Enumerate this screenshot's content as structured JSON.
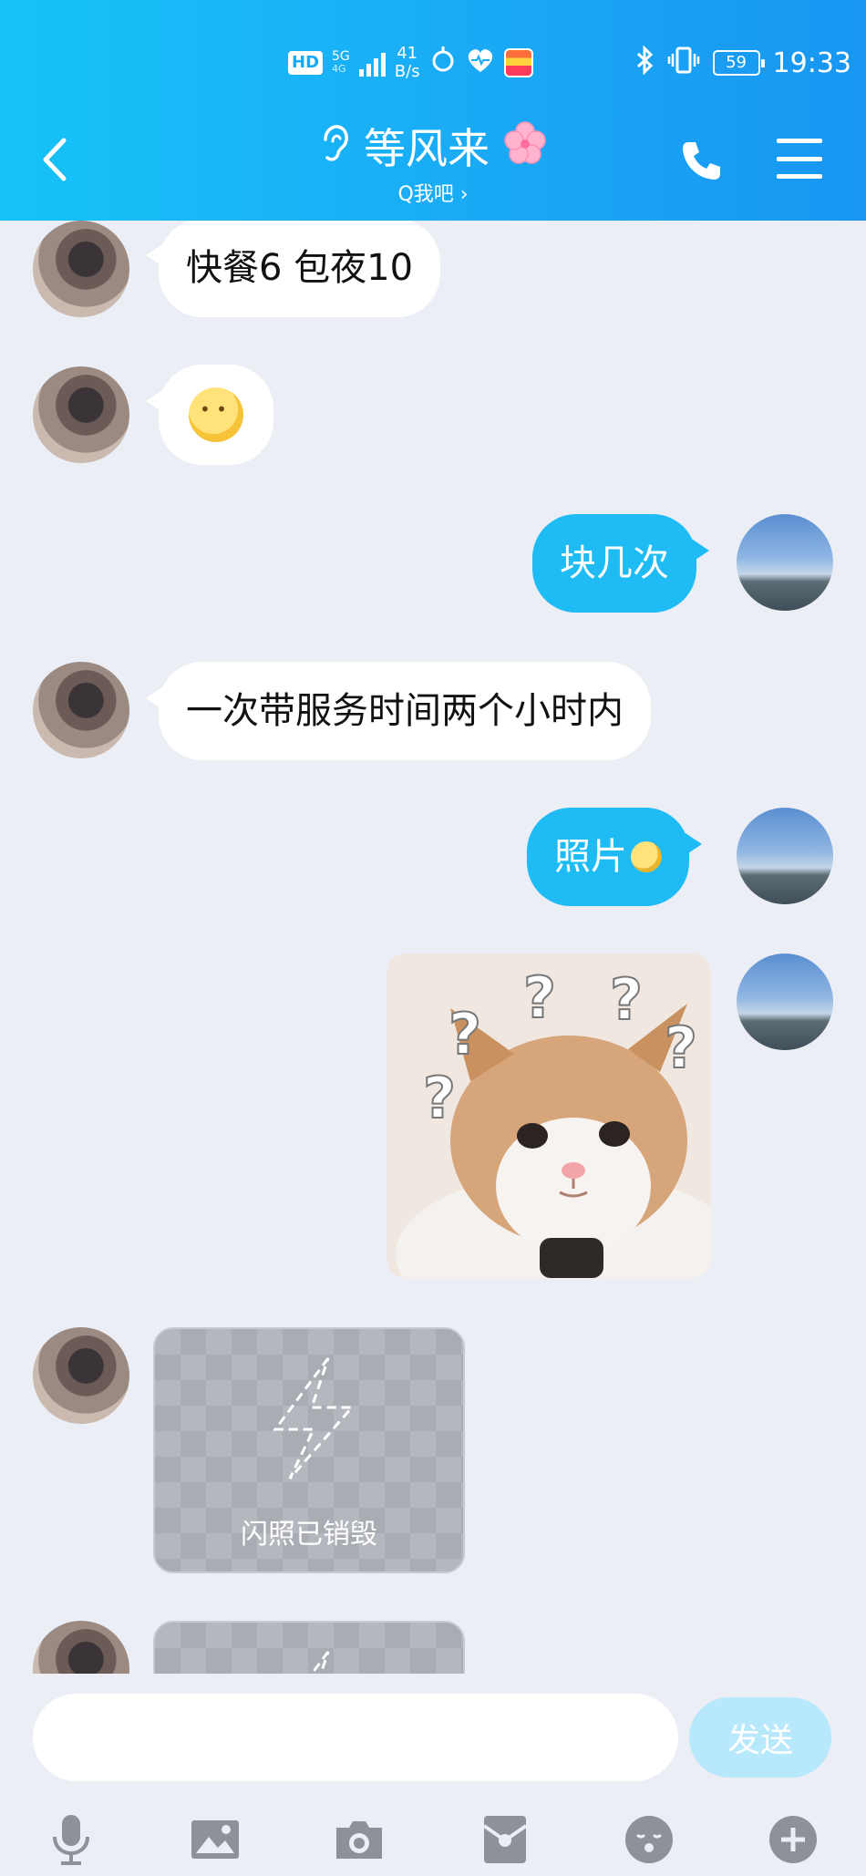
{
  "status_bar": {
    "hd": "HD",
    "network": "5G",
    "network_sub": "4G",
    "speed_value": "41",
    "speed_unit": "B/s",
    "battery": "59",
    "time": "19:33"
  },
  "header": {
    "title": "等风来",
    "subtitle": "Q我吧 ›"
  },
  "messages": [
    {
      "side": "in",
      "text": "快餐6 包夜10"
    },
    {
      "side": "in",
      "type": "emoji",
      "icon": "emoji-thinking-face"
    },
    {
      "side": "out",
      "text": "块几次"
    },
    {
      "side": "in",
      "text": "一次带服务时间两个小时内"
    },
    {
      "side": "out",
      "text": "照片"
    },
    {
      "side": "out",
      "type": "image",
      "icon": "cat-question-marks-image"
    },
    {
      "side": "in",
      "type": "flash",
      "text": "闪照已销毁"
    },
    {
      "side": "in",
      "type": "flash",
      "text": ""
    }
  ],
  "composer": {
    "placeholder": "",
    "send_label": "发送"
  },
  "toolbar_icons": [
    "mic-icon",
    "picture-icon",
    "camera-icon",
    "red-packet-icon",
    "emoji-icon",
    "plus-icon"
  ],
  "colors": {
    "header_gradient_start": "#16c3f7",
    "header_gradient_end": "#1896f2",
    "bubble_out": "#1ebbf5",
    "bubble_in": "#ffffff",
    "background": "#eceef5",
    "send_disabled": "#b8e8fb"
  }
}
